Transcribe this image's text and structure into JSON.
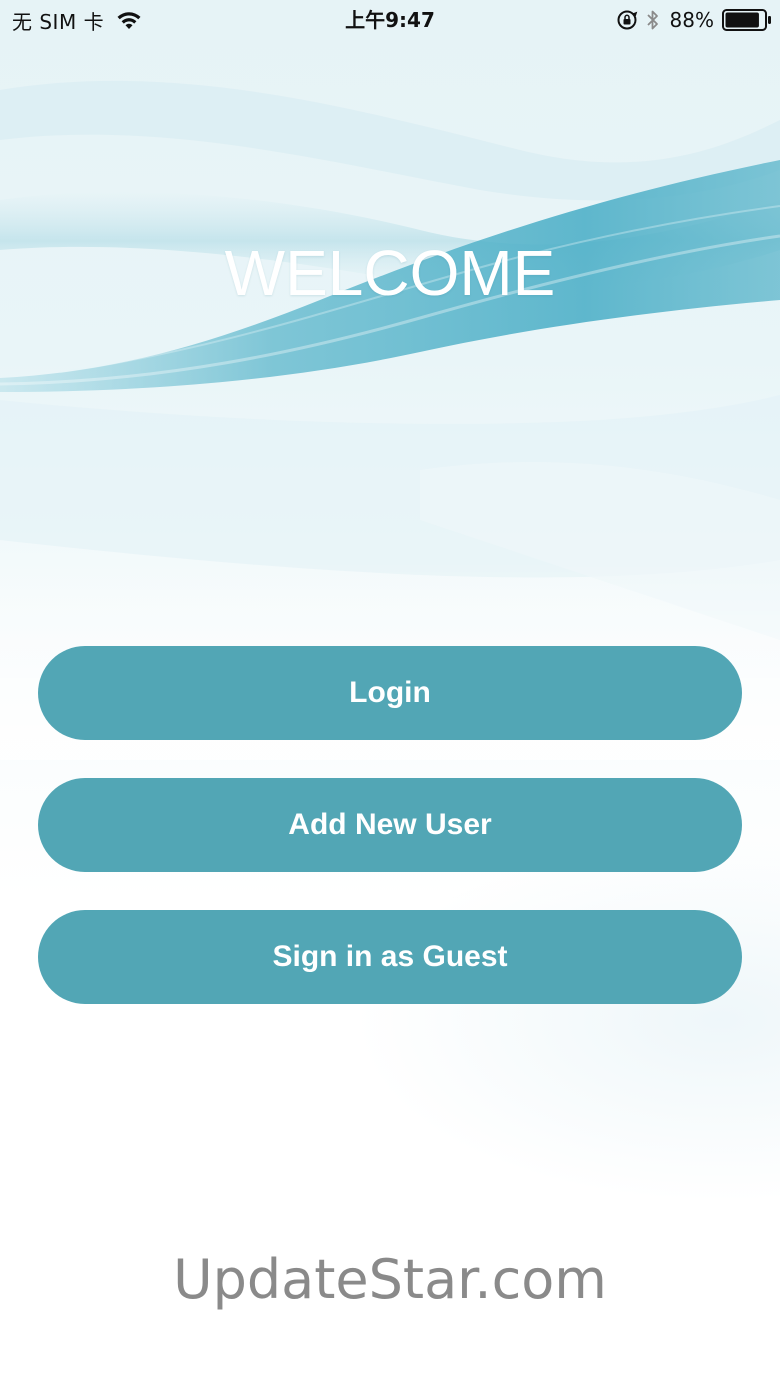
{
  "status_bar": {
    "carrier": "无 SIM 卡",
    "time": "上午9:47",
    "battery_percent": "88%",
    "battery_level": 0.88,
    "icons": [
      "wifi-icon",
      "orientation-lock-icon",
      "bluetooth-icon",
      "battery-icon"
    ]
  },
  "welcome": {
    "title": "WELCOME"
  },
  "actions": {
    "login_label": "Login",
    "add_user_label": "Add New User",
    "guest_label": "Sign in as Guest"
  },
  "watermark": {
    "text": "UpdateStar.com"
  },
  "colors": {
    "button": "#52a6b5",
    "button_text": "#ffffff",
    "wave_accent": "#4fb0c8",
    "title_text": "#ffffff",
    "watermark_text": "#8a8a8a"
  }
}
